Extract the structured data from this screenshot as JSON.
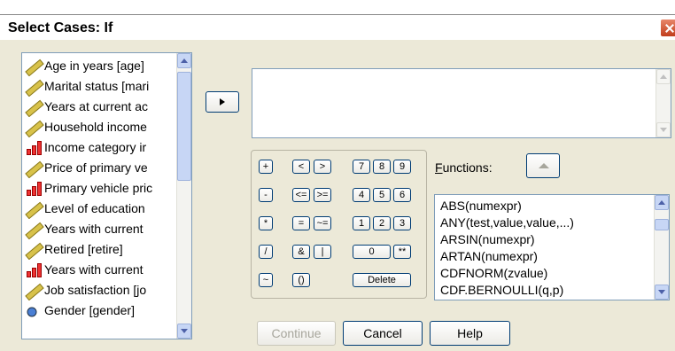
{
  "window": {
    "title": "Select Cases: If"
  },
  "variables": [
    {
      "label": "Age in years [age]",
      "icon": "scale-ruler-icon"
    },
    {
      "label": "Marital status [mari",
      "icon": "scale-ruler-icon"
    },
    {
      "label": "Years at current ac",
      "icon": "scale-ruler-icon"
    },
    {
      "label": "Household income",
      "icon": "scale-ruler-icon"
    },
    {
      "label": "Income category ir",
      "icon": "ordinal-bars-icon"
    },
    {
      "label": "Price of primary ve",
      "icon": "scale-ruler-icon"
    },
    {
      "label": "Primary vehicle pric",
      "icon": "ordinal-bars-icon"
    },
    {
      "label": "Level of education",
      "icon": "scale-ruler-icon"
    },
    {
      "label": "Years with current",
      "icon": "scale-ruler-icon"
    },
    {
      "label": "Retired [retire]",
      "icon": "scale-ruler-icon"
    },
    {
      "label": "Years with current",
      "icon": "ordinal-bars-icon"
    },
    {
      "label": "Job satisfaction [jo",
      "icon": "scale-ruler-icon"
    },
    {
      "label": "Gender [gender]",
      "icon": "nominal-circles-icon"
    }
  ],
  "keypad": [
    {
      "label": "+",
      "name": "key-plus"
    },
    {
      "label": "<",
      "name": "key-less-than"
    },
    {
      "label": ">",
      "name": "key-greater-than"
    },
    {
      "label": "7",
      "name": "key-7"
    },
    {
      "label": "8",
      "name": "key-8"
    },
    {
      "label": "9",
      "name": "key-9"
    },
    {
      "label": "-",
      "name": "key-minus"
    },
    {
      "label": "<=",
      "name": "key-less-equal"
    },
    {
      "label": ">=",
      "name": "key-greater-equal"
    },
    {
      "label": "4",
      "name": "key-4"
    },
    {
      "label": "5",
      "name": "key-5"
    },
    {
      "label": "6",
      "name": "key-6"
    },
    {
      "label": "*",
      "name": "key-multiply"
    },
    {
      "label": "=",
      "name": "key-equals"
    },
    {
      "label": "~=",
      "name": "key-not-equal"
    },
    {
      "label": "1",
      "name": "key-1"
    },
    {
      "label": "2",
      "name": "key-2"
    },
    {
      "label": "3",
      "name": "key-3"
    },
    {
      "label": "/",
      "name": "key-divide"
    },
    {
      "label": "&",
      "name": "key-and"
    },
    {
      "label": "|",
      "name": "key-or"
    },
    {
      "label": "0",
      "name": "key-0"
    },
    {
      "label": ".",
      "name": "key-decimal"
    },
    {
      "label": "**",
      "name": "key-power"
    },
    {
      "label": "~",
      "name": "key-not"
    },
    {
      "label": "()",
      "name": "key-parentheses"
    },
    {
      "label": "Delete",
      "name": "key-delete"
    }
  ],
  "functions": {
    "label_accel": "F",
    "label_rest": "unctions:",
    "items": [
      "ABS(numexpr)",
      "ANY(test,value,value,...)",
      "ARSIN(numexpr)",
      "ARTAN(numexpr)",
      "CDFNORM(zvalue)",
      "CDF.BERNOULLI(q,p)"
    ]
  },
  "buttons": {
    "continue": "Continue",
    "cancel": "Cancel",
    "help": "Help"
  },
  "colors": {
    "dialog_bg": "#ece9d8",
    "button_border": "#003c74",
    "field_border": "#7f9db9"
  }
}
